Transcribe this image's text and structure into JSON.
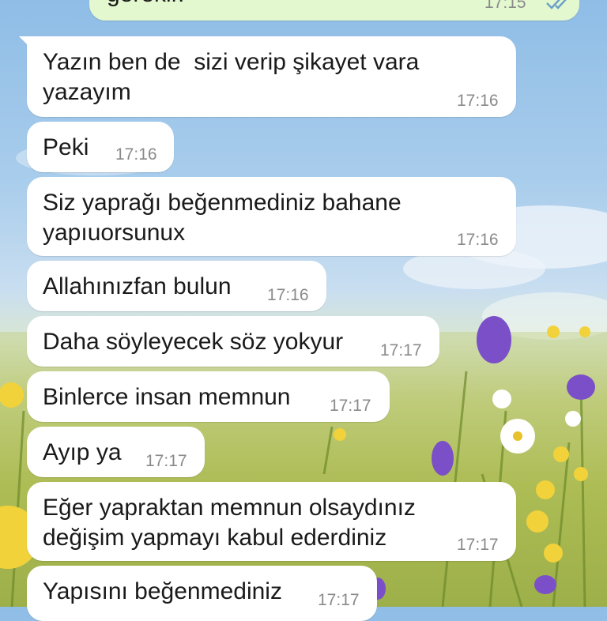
{
  "colors": {
    "incoming_bubble": "#ffffff",
    "outgoing_bubble": "#e3f8cf",
    "timestamp": "#8a8a8a",
    "read_ticks": "#6aa0c8"
  },
  "outgoing_partial": {
    "text": "gerekir.",
    "time": "17:15",
    "status_icon": "double-check-read-icon"
  },
  "messages": [
    {
      "line1": "Yazın ben de  sizi verip şikayet vara",
      "line2": "yazayım",
      "time": "17:16"
    },
    {
      "line1": "Peki",
      "time": "17:16"
    },
    {
      "line1": "Siz yaprağı beğenmediniz bahane",
      "line2": "yapıuorsunux",
      "time": "17:16"
    },
    {
      "line1": "Allahınızfan bulun",
      "time": "17:16"
    },
    {
      "line1": "Daha söyleyecek söz yokyur",
      "time": "17:17"
    },
    {
      "line1": "Binlerce insan memnun",
      "time": "17:17"
    },
    {
      "line1": "Ayıp ya",
      "time": "17:17"
    },
    {
      "line1": "Eğer yapraktan memnun olsaydınız",
      "line2": "değişim yapmayı kabul ederdiniz",
      "time": "17:17"
    },
    {
      "line1": "Yapısını beğenmediniz",
      "time": "17:17"
    }
  ]
}
